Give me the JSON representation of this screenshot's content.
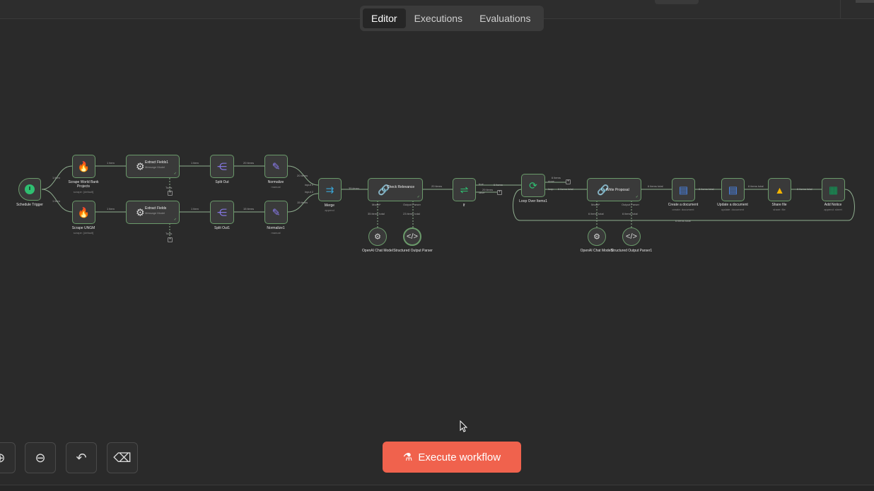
{
  "tabs": [
    "Editor",
    "Executions",
    "Evaluations"
  ],
  "active_tab": "Editor",
  "execute_label": "Execute workflow",
  "accent": "#f0624d",
  "node_border": "#6a9a6a",
  "nodes": {
    "schedule": {
      "label": "Schedule Trigger"
    },
    "scrape_wb": {
      "label": "Scrape World Bank Projects",
      "sub": "scrape: [default]"
    },
    "scrape_ungm": {
      "label": "Scrape UNGM",
      "sub": "scrape: [default]"
    },
    "extract1": {
      "title": "Extract Fields1",
      "sub": "Message Model"
    },
    "extract": {
      "title": "Extract Fields",
      "sub": "Message Model"
    },
    "split": {
      "label": "Split Out"
    },
    "split1": {
      "label": "Split Out1"
    },
    "normalize": {
      "label": "Normalize",
      "sub": "manual"
    },
    "normalize1": {
      "label": "Normalize1",
      "sub": "manual"
    },
    "merge": {
      "label": "Merge",
      "sub": "append"
    },
    "check": {
      "title": "Check Relevance"
    },
    "if": {
      "label": "If"
    },
    "loop": {
      "label": "Loop Over Items1"
    },
    "write": {
      "title": "Write Proposal"
    },
    "create_doc": {
      "label": "Create a document",
      "sub": "create: document"
    },
    "update_doc": {
      "label": "Update a document",
      "sub": "update: document"
    },
    "share": {
      "label": "Share file",
      "sub": "share: file"
    },
    "notice": {
      "label": "Add Notice",
      "sub": "append: sheet"
    },
    "openai1": {
      "label": "OpenAI Chat Model"
    },
    "parser1": {
      "label": "Structured Output Parser"
    },
    "openai2": {
      "label": "OpenAI Chat Model1"
    },
    "parser2": {
      "label": "Structured Output Parser1"
    }
  },
  "edges": {
    "e1": "1 item",
    "e2": "1 item",
    "e3": "1 item",
    "e4": "1 item",
    "e5": "1 item",
    "e6": "1 item",
    "e7": "20 items",
    "e8": "15 items",
    "e9": "20 items",
    "e10": "15 items",
    "e11": "35 items",
    "e12": "20 items",
    "e13": "6 items",
    "e14": "29 items",
    "e15": "6 items total",
    "e16": "6 items total",
    "e17": "6 items total",
    "e18": "6 items total",
    "e19": "6 items total",
    "e20": "35 items total",
    "e21": "23 items total",
    "e22": "6 items total",
    "e23": "6 items total",
    "e24": "6 items",
    "e25": "6 items total",
    "input1": "input 1",
    "input2": "input 2",
    "true": "true",
    "false": "false",
    "done": "done",
    "loop": "loop",
    "model": "Model*",
    "parser": "Output Parser",
    "tools": "Tools"
  }
}
